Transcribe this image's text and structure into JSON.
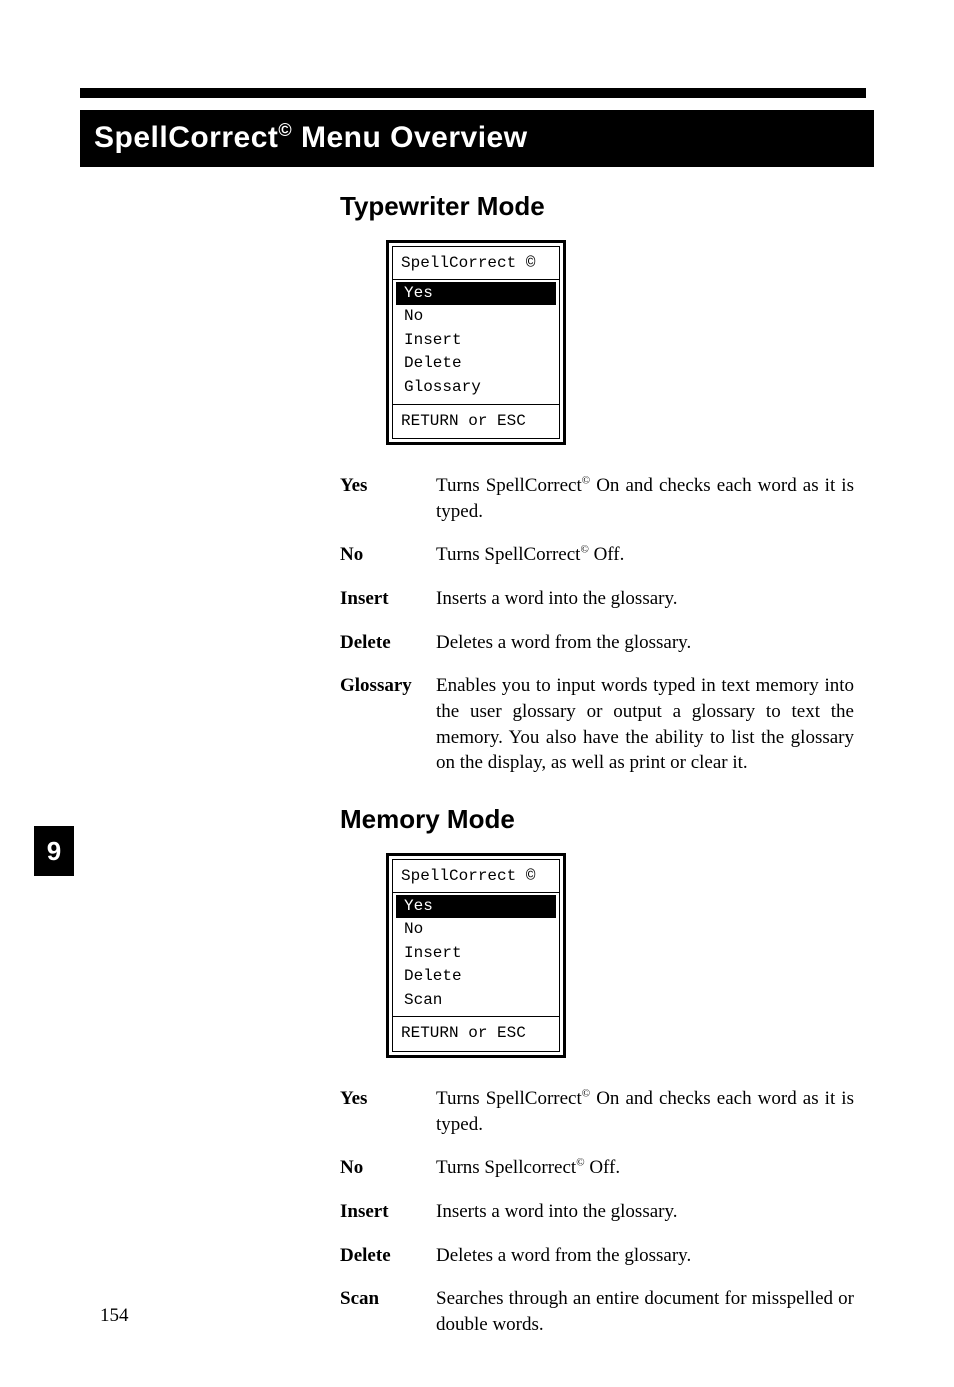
{
  "page_number": "154",
  "chapter_tab": "9",
  "title_main": "SpellCorrect",
  "title_sup": "©",
  "title_rest": " Menu Overview",
  "sections": {
    "typewriter": {
      "heading": "Typewriter Mode",
      "menu": {
        "title": "SpellCorrect ©",
        "items": [
          "Yes",
          "No",
          "Insert",
          "Delete",
          "Glossary"
        ],
        "selected": "Yes",
        "footer": "RETURN or ESC"
      },
      "defs": [
        {
          "term": "Yes",
          "desc_pre": "Turns SpellCorrect",
          "sup": "©",
          "desc_post": " On and checks each word as it is typed."
        },
        {
          "term": "No",
          "desc_pre": "Turns SpellCorrect",
          "sup": "©",
          "desc_post": " Off."
        },
        {
          "term": "Insert",
          "desc_pre": "Inserts a word into the glossary.",
          "sup": "",
          "desc_post": ""
        },
        {
          "term": "Delete",
          "desc_pre": "Deletes a word from the glossary.",
          "sup": "",
          "desc_post": ""
        },
        {
          "term": "Glossary",
          "desc_pre": "Enables you to input words typed in text memory into the user glossary or output a glossary to text the memory. You also have the ability to list the glossary on the display, as well as print or clear it.",
          "sup": "",
          "desc_post": ""
        }
      ]
    },
    "memory": {
      "heading": "Memory Mode",
      "menu": {
        "title": "SpellCorrect ©",
        "items": [
          "Yes",
          "No",
          "Insert",
          "Delete",
          "Scan"
        ],
        "selected": "Yes",
        "footer": "RETURN or ESC"
      },
      "defs": [
        {
          "term": "Yes",
          "desc_pre": "Turns SpellCorrect",
          "sup": "©",
          "desc_post": " On and checks each word as it is typed."
        },
        {
          "term": "No",
          "desc_pre": "Turns Spellcorrect",
          "sup": "©",
          "desc_post": " Off."
        },
        {
          "term": "Insert",
          "desc_pre": "Inserts a word into the glossary.",
          "sup": "",
          "desc_post": ""
        },
        {
          "term": "Delete",
          "desc_pre": "Deletes a word from the glossary.",
          "sup": "",
          "desc_post": ""
        },
        {
          "term": "Scan",
          "desc_pre": "Searches through an entire document for misspelled or double words.",
          "sup": "",
          "desc_post": ""
        }
      ]
    }
  }
}
